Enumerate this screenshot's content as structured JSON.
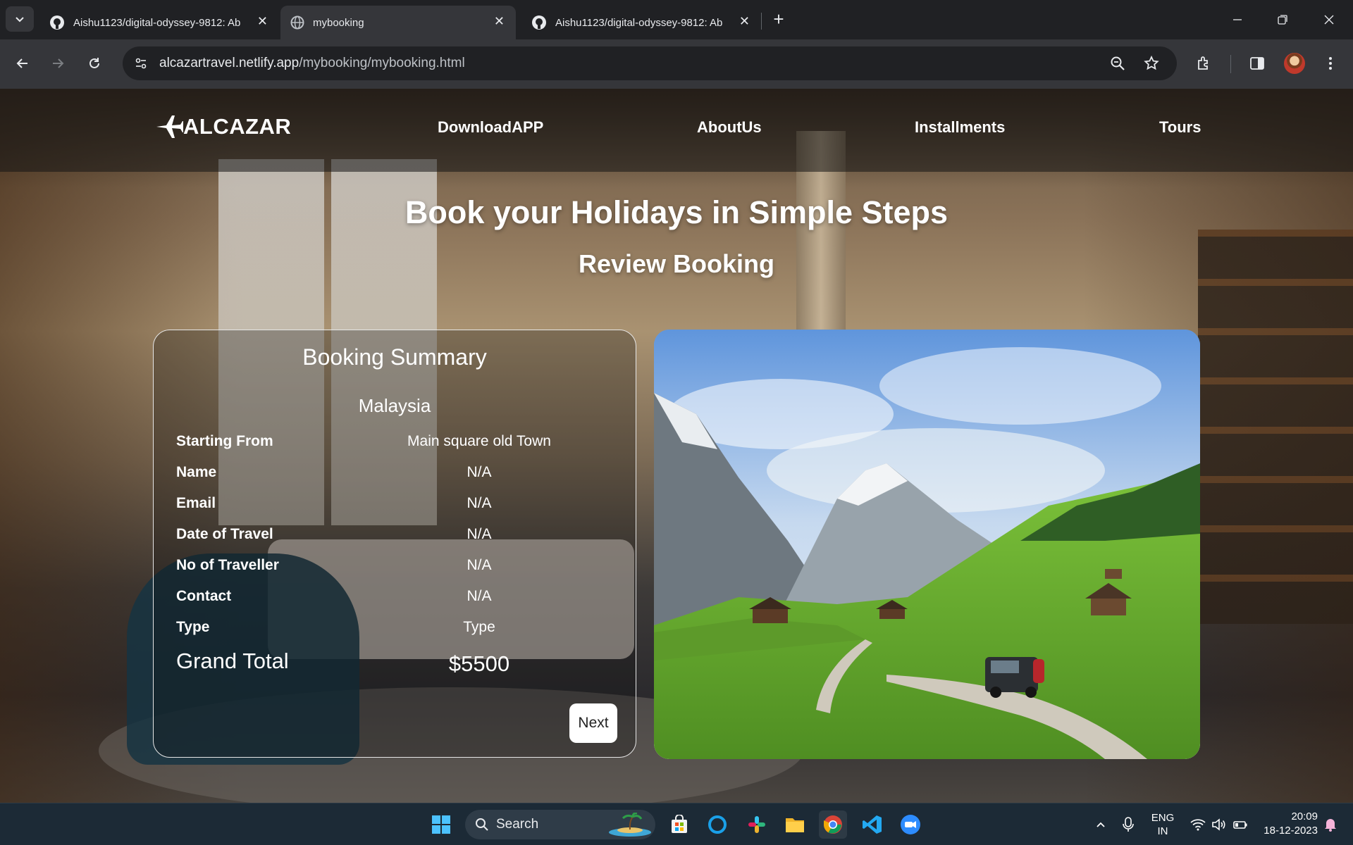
{
  "browser": {
    "tabs": [
      {
        "title": "Aishu1123/digital-odyssey-9812: Abo",
        "icon": "github-icon",
        "active": false
      },
      {
        "title": "mybooking",
        "icon": "globe-icon",
        "active": true
      },
      {
        "title": "Aishu1123/digital-odyssey-9812: Abo",
        "icon": "github-icon",
        "active": false
      }
    ],
    "url_host": "alcazartravel.netlify.app",
    "url_path": "/mybooking/mybooking.html"
  },
  "site": {
    "logo_text": "ALCAZAR",
    "nav": [
      "DownloadAPP",
      "AboutUs",
      "Installments",
      "Tours"
    ],
    "hero_title": "Book your Holidays in Simple Steps",
    "hero_subtitle": "Review Booking"
  },
  "summary": {
    "title": "Booking Summary",
    "destination": "Malaysia",
    "rows": [
      {
        "label": "Starting From",
        "value": "Main square old Town"
      },
      {
        "label": "Name",
        "value": "N/A"
      },
      {
        "label": "Email",
        "value": "N/A"
      },
      {
        "label": "Date of Travel",
        "value": "N/A"
      },
      {
        "label": "No of Traveller",
        "value": "N/A"
      },
      {
        "label": "Contact",
        "value": "N/A"
      },
      {
        "label": "Type",
        "value": "Type"
      }
    ],
    "total_label": "Grand Total",
    "total_value": "$5500",
    "next_label": "Next"
  },
  "taskbar": {
    "search_label": "Search",
    "lang_line1": "ENG",
    "lang_line2": "IN",
    "time": "20:09",
    "date": "18-12-2023"
  },
  "colors": {
    "chrome_dark": "#202124",
    "chrome_toolbar": "#35363a",
    "taskbar": "#1c2a36"
  }
}
